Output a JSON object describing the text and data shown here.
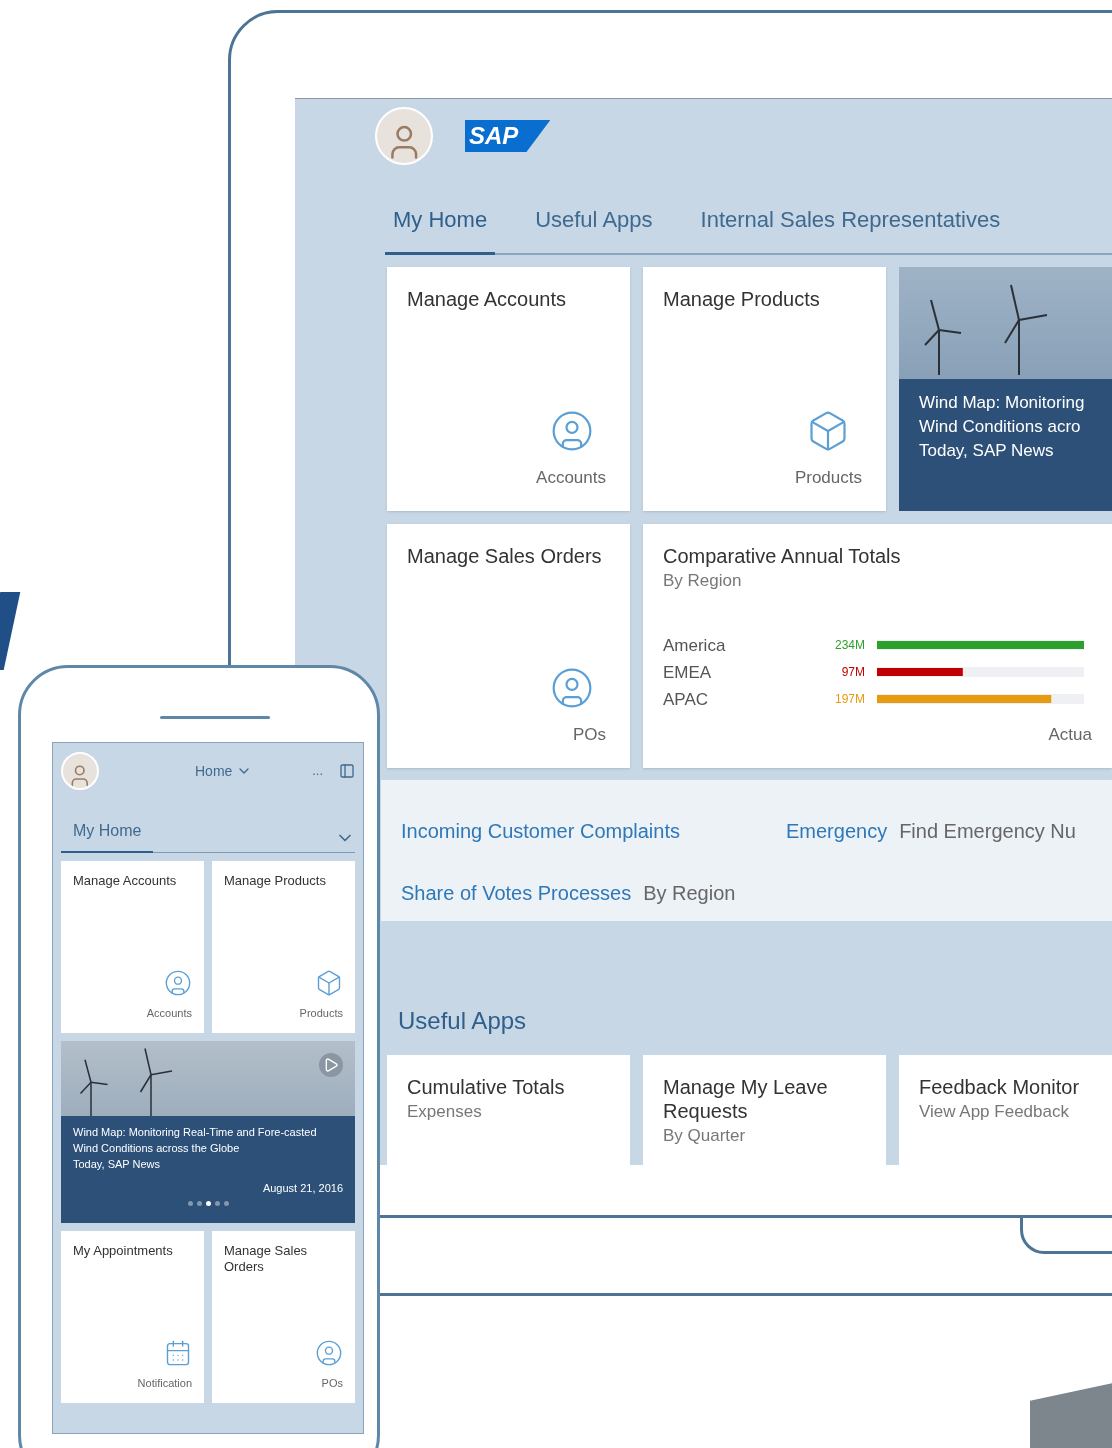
{
  "desktop": {
    "logo": "SAP",
    "tabs": [
      {
        "label": "My Home",
        "selected": true
      },
      {
        "label": "Useful Apps",
        "selected": false
      },
      {
        "label": "Internal Sales Representatives",
        "selected": false
      }
    ],
    "tiles": [
      {
        "kind": "person",
        "title": "Manage Accounts",
        "footer": "Accounts"
      },
      {
        "kind": "box",
        "title": "Manage Products",
        "footer": "Products"
      },
      {
        "kind": "news",
        "lines": [
          "Wind Map: Monitoring",
          "Wind Conditions acro",
          "Today, SAP News"
        ]
      },
      {
        "kind": "person",
        "title": "Manage Sales Orders",
        "footer": "POs"
      },
      {
        "kind": "chart",
        "title": "Comparative Annual Totals",
        "subtitle": "By Region",
        "footer": "Actua",
        "chart_data": {
          "type": "bar",
          "orientation": "horizontal",
          "categories": [
            "America",
            "EMEA",
            "APAC"
          ],
          "values": [
            234,
            97,
            197
          ],
          "value_labels": [
            "234M",
            "97M",
            "197M"
          ],
          "colors": [
            "#2ca02c",
            "#c00000",
            "#e89a10"
          ],
          "xlim": [
            0,
            234
          ]
        }
      }
    ],
    "links": [
      {
        "label": "Incoming Customer Complaints"
      },
      {
        "label": "Emergency",
        "sub": "Find Emergency Nu"
      },
      {
        "label": "Share of Votes Processes",
        "sub": "By Region"
      }
    ],
    "section_title": "Useful Apps",
    "app_tiles": [
      {
        "title": "Cumulative Totals",
        "sub": "Expenses"
      },
      {
        "title": "Manage My Leave Requests",
        "sub": "By Quarter"
      },
      {
        "title": "Feedback Monitor",
        "sub": "View App Feedback"
      }
    ]
  },
  "phone": {
    "menu_label": "Home",
    "more": "...",
    "tab": {
      "label": "My Home",
      "selected": true
    },
    "tiles_top": [
      {
        "kind": "person",
        "title": "Manage Accounts",
        "footer": "Accounts"
      },
      {
        "kind": "box",
        "title": "Manage Products",
        "footer": "Products"
      }
    ],
    "news": {
      "headline": "Wind Map: Monitoring Real-Time and Fore-casted Wind Conditions across the Globe",
      "source": "Today, SAP News",
      "date": "August 21, 2016",
      "dots": [
        {
          "selected": false
        },
        {
          "selected": false
        },
        {
          "selected": true
        },
        {
          "selected": false
        },
        {
          "selected": false
        }
      ]
    },
    "tiles_bottom": [
      {
        "kind": "calendar",
        "title": "My Appointments",
        "footer": "Notification"
      },
      {
        "kind": "person",
        "title": "Manage Sales Orders",
        "footer": "POs"
      }
    ]
  }
}
